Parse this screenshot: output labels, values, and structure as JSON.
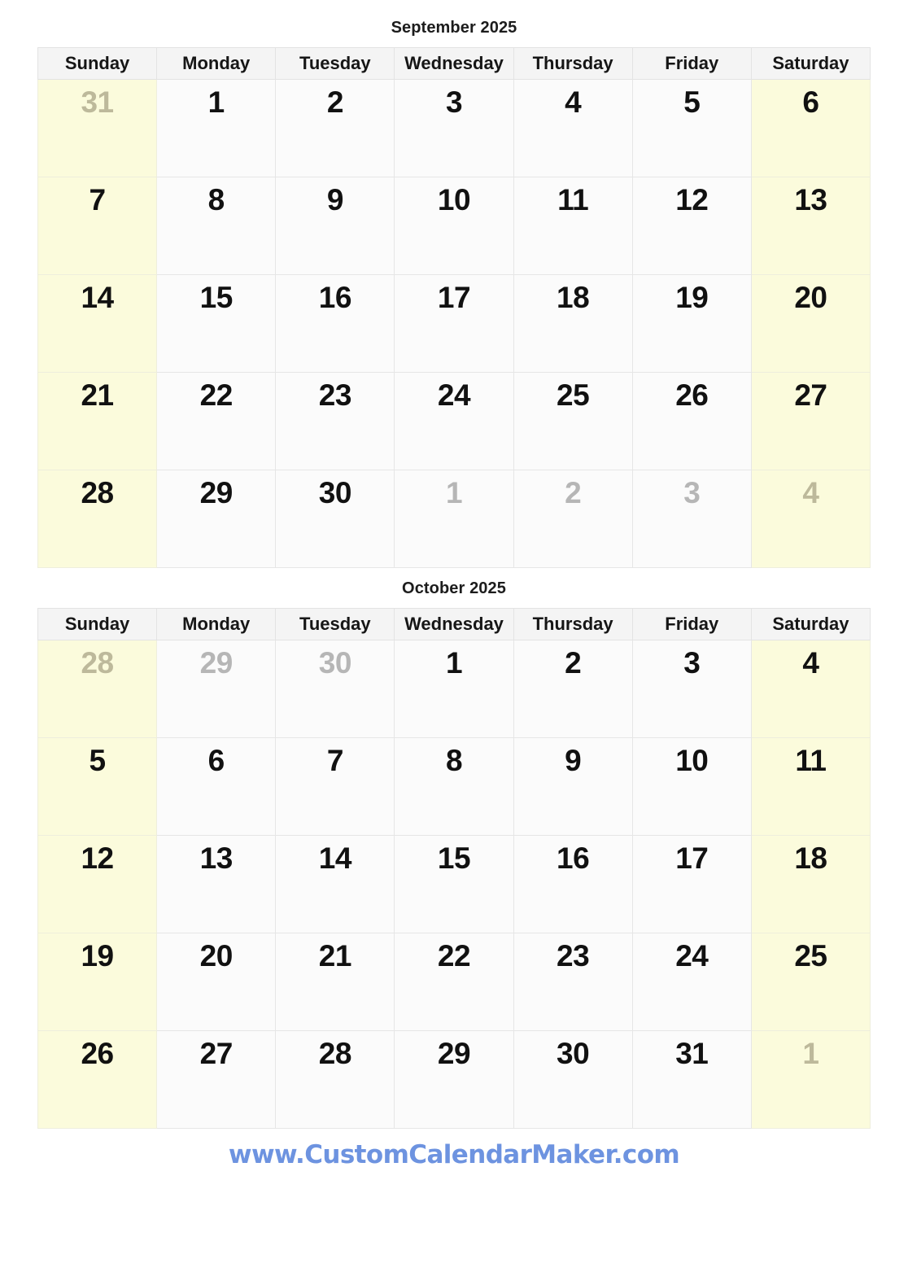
{
  "document": {
    "type": "two-month-calendar",
    "year": "2025"
  },
  "weekday_headers": [
    "Sunday",
    "Monday",
    "Tuesday",
    "Wednesday",
    "Thursday",
    "Friday",
    "Saturday"
  ],
  "colors": {
    "weekend_background": "#fbfbdc",
    "weekday_background": "#fbfbfb",
    "header_background": "#f4f4f4",
    "grid_border": "#e6e6e6",
    "day_number": "#111111",
    "muted_day_number": "#b6b6b6",
    "muted_weekend_day_number": "#bdb99b",
    "footer_link": "#6d93e0"
  },
  "months": [
    {
      "title": "September 2025",
      "weeks": [
        [
          {
            "day": "31",
            "muted": true,
            "weekend": true
          },
          {
            "day": "1",
            "muted": false,
            "weekend": false
          },
          {
            "day": "2",
            "muted": false,
            "weekend": false
          },
          {
            "day": "3",
            "muted": false,
            "weekend": false
          },
          {
            "day": "4",
            "muted": false,
            "weekend": false
          },
          {
            "day": "5",
            "muted": false,
            "weekend": false
          },
          {
            "day": "6",
            "muted": false,
            "weekend": true
          }
        ],
        [
          {
            "day": "7",
            "muted": false,
            "weekend": true
          },
          {
            "day": "8",
            "muted": false,
            "weekend": false
          },
          {
            "day": "9",
            "muted": false,
            "weekend": false
          },
          {
            "day": "10",
            "muted": false,
            "weekend": false
          },
          {
            "day": "11",
            "muted": false,
            "weekend": false
          },
          {
            "day": "12",
            "muted": false,
            "weekend": false
          },
          {
            "day": "13",
            "muted": false,
            "weekend": true
          }
        ],
        [
          {
            "day": "14",
            "muted": false,
            "weekend": true
          },
          {
            "day": "15",
            "muted": false,
            "weekend": false
          },
          {
            "day": "16",
            "muted": false,
            "weekend": false
          },
          {
            "day": "17",
            "muted": false,
            "weekend": false
          },
          {
            "day": "18",
            "muted": false,
            "weekend": false
          },
          {
            "day": "19",
            "muted": false,
            "weekend": false
          },
          {
            "day": "20",
            "muted": false,
            "weekend": true
          }
        ],
        [
          {
            "day": "21",
            "muted": false,
            "weekend": true
          },
          {
            "day": "22",
            "muted": false,
            "weekend": false
          },
          {
            "day": "23",
            "muted": false,
            "weekend": false
          },
          {
            "day": "24",
            "muted": false,
            "weekend": false
          },
          {
            "day": "25",
            "muted": false,
            "weekend": false
          },
          {
            "day": "26",
            "muted": false,
            "weekend": false
          },
          {
            "day": "27",
            "muted": false,
            "weekend": true
          }
        ],
        [
          {
            "day": "28",
            "muted": false,
            "weekend": true
          },
          {
            "day": "29",
            "muted": false,
            "weekend": false
          },
          {
            "day": "30",
            "muted": false,
            "weekend": false
          },
          {
            "day": "1",
            "muted": true,
            "weekend": false
          },
          {
            "day": "2",
            "muted": true,
            "weekend": false
          },
          {
            "day": "3",
            "muted": true,
            "weekend": false
          },
          {
            "day": "4",
            "muted": true,
            "weekend": true
          }
        ]
      ]
    },
    {
      "title": "October 2025",
      "weeks": [
        [
          {
            "day": "28",
            "muted": true,
            "weekend": true
          },
          {
            "day": "29",
            "muted": true,
            "weekend": false
          },
          {
            "day": "30",
            "muted": true,
            "weekend": false
          },
          {
            "day": "1",
            "muted": false,
            "weekend": false
          },
          {
            "day": "2",
            "muted": false,
            "weekend": false
          },
          {
            "day": "3",
            "muted": false,
            "weekend": false
          },
          {
            "day": "4",
            "muted": false,
            "weekend": true
          }
        ],
        [
          {
            "day": "5",
            "muted": false,
            "weekend": true
          },
          {
            "day": "6",
            "muted": false,
            "weekend": false
          },
          {
            "day": "7",
            "muted": false,
            "weekend": false
          },
          {
            "day": "8",
            "muted": false,
            "weekend": false
          },
          {
            "day": "9",
            "muted": false,
            "weekend": false
          },
          {
            "day": "10",
            "muted": false,
            "weekend": false
          },
          {
            "day": "11",
            "muted": false,
            "weekend": true
          }
        ],
        [
          {
            "day": "12",
            "muted": false,
            "weekend": true
          },
          {
            "day": "13",
            "muted": false,
            "weekend": false
          },
          {
            "day": "14",
            "muted": false,
            "weekend": false
          },
          {
            "day": "15",
            "muted": false,
            "weekend": false
          },
          {
            "day": "16",
            "muted": false,
            "weekend": false
          },
          {
            "day": "17",
            "muted": false,
            "weekend": false
          },
          {
            "day": "18",
            "muted": false,
            "weekend": true
          }
        ],
        [
          {
            "day": "19",
            "muted": false,
            "weekend": true
          },
          {
            "day": "20",
            "muted": false,
            "weekend": false
          },
          {
            "day": "21",
            "muted": false,
            "weekend": false
          },
          {
            "day": "22",
            "muted": false,
            "weekend": false
          },
          {
            "day": "23",
            "muted": false,
            "weekend": false
          },
          {
            "day": "24",
            "muted": false,
            "weekend": false
          },
          {
            "day": "25",
            "muted": false,
            "weekend": true
          }
        ],
        [
          {
            "day": "26",
            "muted": false,
            "weekend": true
          },
          {
            "day": "27",
            "muted": false,
            "weekend": false
          },
          {
            "day": "28",
            "muted": false,
            "weekend": false
          },
          {
            "day": "29",
            "muted": false,
            "weekend": false
          },
          {
            "day": "30",
            "muted": false,
            "weekend": false
          },
          {
            "day": "31",
            "muted": false,
            "weekend": false
          },
          {
            "day": "1",
            "muted": true,
            "weekend": true
          }
        ]
      ]
    }
  ],
  "footer": {
    "link_text": "www.CustomCalendarMaker.com"
  }
}
